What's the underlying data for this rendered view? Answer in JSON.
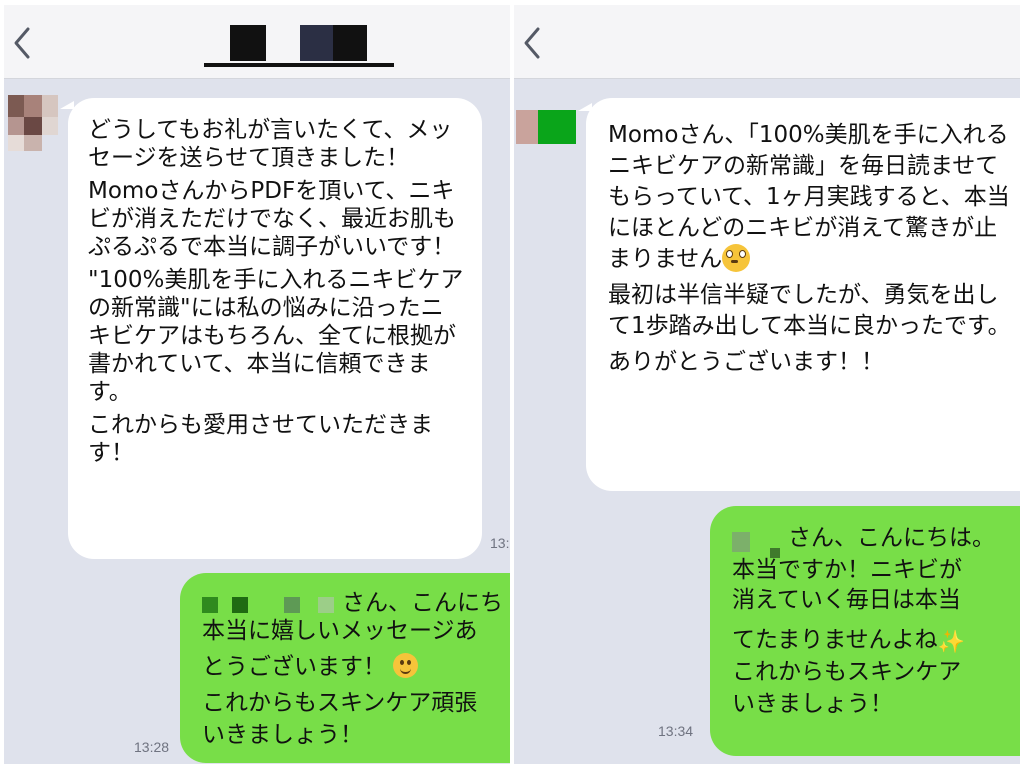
{
  "left_chat": {
    "incoming_paragraphs": [
      "どうしてもお礼が言いたくて、メッセージを送らせて頂きました！",
      "MomoさんからPDFを頂いて、ニキビが消えただけでなく、最近お肌もぷるぷるで本当に調子がいいです！",
      "\"100%美肌を手に入れるニキビケアの新常識\"には私の悩みに沿ったニキビケアはもちろん、全てに根拠が書かれていて、本当に信頼できます。",
      "これからも愛用させていただきます！"
    ],
    "incoming_time": "13:2",
    "outgoing_greeting": "さん、こんにち",
    "outgoing_lines": [
      "本当に嬉しいメッセージあ",
      "とうございます！",
      "これからもスキンケア頑張",
      "いきましょう！"
    ],
    "outgoing_emoji": "smile-emoji",
    "outgoing_time": "13:28"
  },
  "right_chat": {
    "incoming_paragraph_1": "Momoさん、「100%美肌を手に入れるニキビケアの新常識」を毎日読ませてもらっていて、1ヶ月実践すると、本当にほとんどのニキビが消えて驚きが止まりません",
    "incoming_emoji": "flushed-face-emoji",
    "incoming_paragraph_2": "最初は半信半疑でしたが、勇気を出して1歩踏み出して本当に良かったです。",
    "incoming_paragraph_3": "ありがとうございます！！",
    "outgoing_greeting": "さん、こんにちは。",
    "outgoing_lines": [
      "本当ですか！ニキビが",
      "消えていく毎日は本当",
      "てたまりませんよね",
      "これからもスキンケア",
      "いきましょう！"
    ],
    "outgoing_emoji": "sparkles-emoji",
    "outgoing_time": "13:34"
  },
  "colors": {
    "chat_background": "#dfe2ec",
    "incoming_bubble": "#ffffff",
    "outgoing_bubble": "#78de48",
    "header": "#f5f5f7"
  },
  "icons": [
    "chevron-left-icon"
  ]
}
